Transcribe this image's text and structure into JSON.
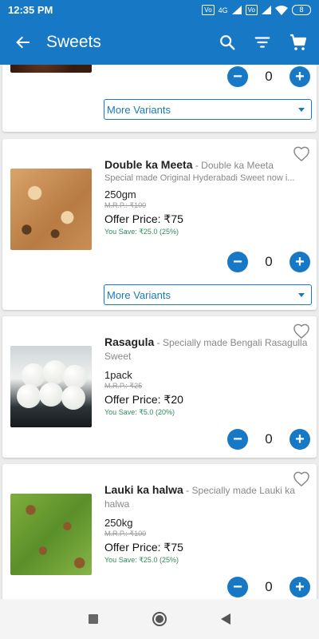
{
  "status_bar": {
    "time": "12:35 PM",
    "signal_badges": [
      "Vo",
      "4G",
      "Vo"
    ],
    "battery": "8"
  },
  "app_bar": {
    "title": "Sweets",
    "icons": [
      "back-arrow-icon",
      "search-icon",
      "filter-icon",
      "cart-icon"
    ]
  },
  "products": [
    {
      "quantity_count": "0",
      "variants_label": "More Variants"
    },
    {
      "name": "Double ka Meeta",
      "separator": "-",
      "subtitle": "Double ka Meeta",
      "description": "Special made Original Hyderabadi Sweet now i...",
      "pack_size": "250gm",
      "mrp": "M.R.P.: ₹100",
      "offer_price": "Offer Price: ₹75",
      "you_save": "You Save: ₹25.0 (25%)",
      "quantity_count": "0",
      "variants_label": "More Variants"
    },
    {
      "name": "Rasagula",
      "separator": "-",
      "subtitle": "Specially made Bengali Rasagulla",
      "subtitle_wrap": "Sweet",
      "pack_size": "1pack",
      "mrp": "M.R.P.: ₹25",
      "offer_price": "Offer Price: ₹20",
      "you_save": "You Save: ₹5.0 (20%)",
      "quantity_count": "0"
    },
    {
      "name": "Lauki ka halwa",
      "separator": "-",
      "subtitle": "Specially made Lauki ka",
      "subtitle_wrap": "halwa",
      "pack_size": "250kg",
      "mrp": "M.R.P.: ₹100",
      "offer_price": "Offer Price: ₹75",
      "you_save": "You Save: ₹25.0 (25%)",
      "quantity_count": "0"
    }
  ],
  "buttons": {
    "minus": "−",
    "plus": "+"
  },
  "colors": {
    "primary": "#1778c6",
    "save_text": "#2e8b57"
  }
}
